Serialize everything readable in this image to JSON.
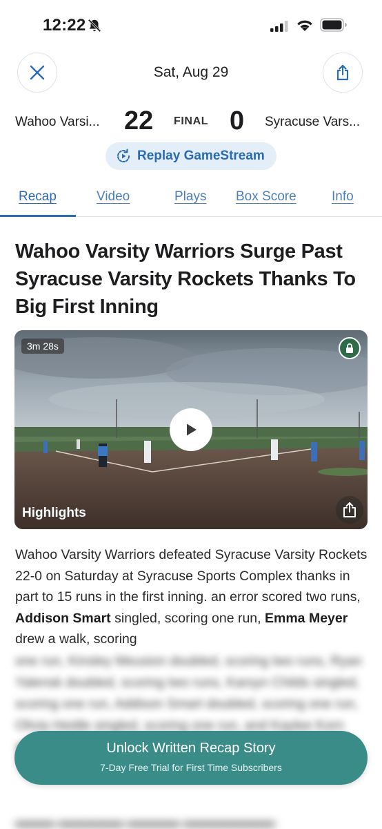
{
  "status_bar": {
    "time": "12:22"
  },
  "header": {
    "date": "Sat, Aug 29"
  },
  "score": {
    "home_team": "Wahoo Varsi...",
    "home_score": "22",
    "status": "FINAL",
    "away_score": "0",
    "away_team": "Syracuse Vars..."
  },
  "replay": {
    "label": "Replay GameStream"
  },
  "tabs": [
    {
      "label": "Recap"
    },
    {
      "label": "Video"
    },
    {
      "label": "Plays"
    },
    {
      "label": "Box Score"
    },
    {
      "label": "Info"
    }
  ],
  "article": {
    "headline": "Wahoo Varsity Warriors Surge Past Syracuse Varsity Rockets Thanks To Big First Inning",
    "video": {
      "duration": "3m 28s",
      "label": "Highlights"
    },
    "body": {
      "p1": "Wahoo Varsity Warriors defeated Syracuse Varsity Rockets 22-0 on Saturday at Syracuse Sports Complex thanks in part to 15 runs in the first inning. an error scored two runs, ",
      "name1": "Addison Smart",
      "p2": " singled, scoring one run, ",
      "name2": "Emma Meyer",
      "p3": " drew a walk, scoring"
    },
    "blurred_text": "one run, Kinsley Meusion doubled, scoring two runs, Ryan Yalensk doubled, scoring two runs, Karsyn Childs singled, scoring one run, Addison Smart doubled, scoring one run, Olivia Heidle singled, scoring one run, and Kaylee Korn singled, scoring two runs."
  },
  "unlock": {
    "title": "Unlock Written Recap Story",
    "subtitle": "7-Day Free Trial for First Time Subscribers"
  }
}
